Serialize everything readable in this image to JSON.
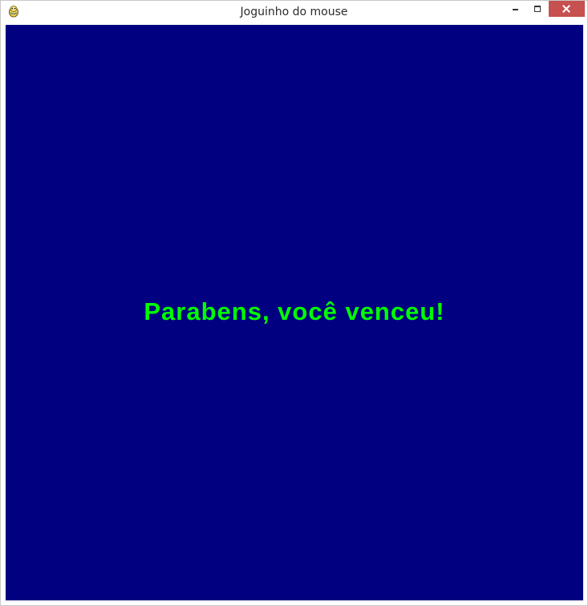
{
  "window": {
    "title": "Joguinho do mouse",
    "icon": "pygame-snake-icon",
    "controls": {
      "minimize": "minimize-icon",
      "maximize": "maximize-icon",
      "close": "close-icon"
    }
  },
  "game": {
    "background_color": "#000080",
    "message": "Parabens, você venceu!",
    "message_color": "#00ff00"
  }
}
